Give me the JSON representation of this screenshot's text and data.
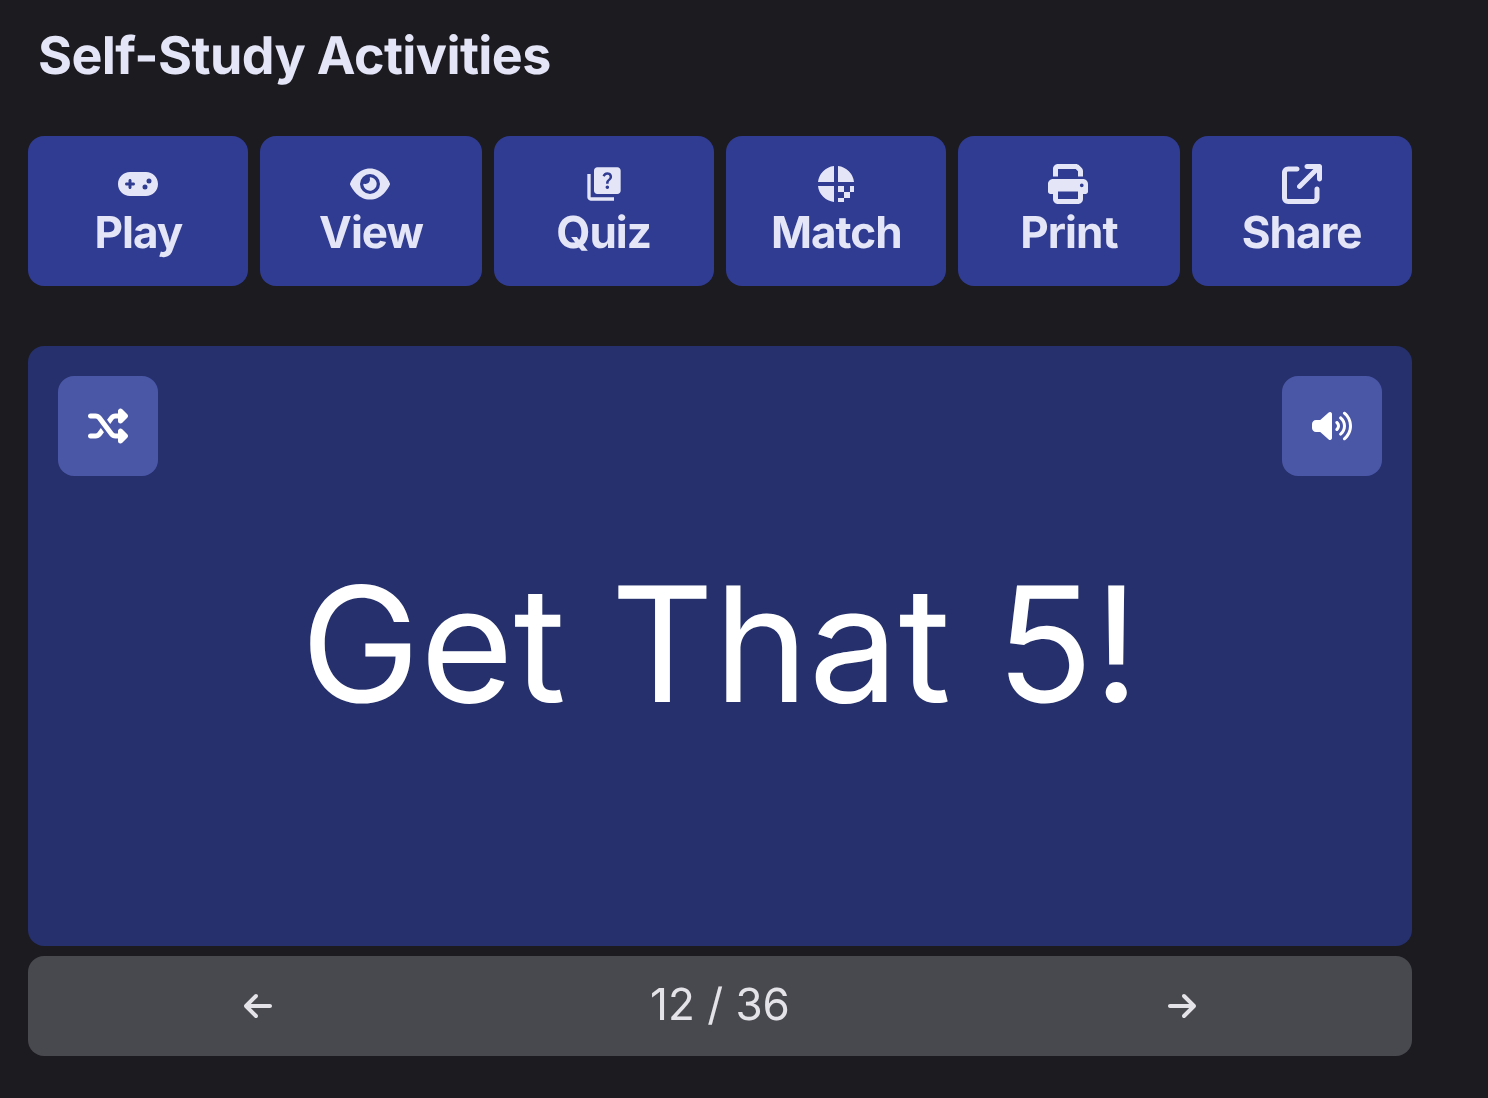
{
  "title": "Self-Study Activities",
  "activities": [
    {
      "kind": "play",
      "label": "Play"
    },
    {
      "kind": "view",
      "label": "View"
    },
    {
      "kind": "quiz",
      "label": "Quiz"
    },
    {
      "kind": "match",
      "label": "Match"
    },
    {
      "kind": "print",
      "label": "Print"
    },
    {
      "kind": "share",
      "label": "Share"
    }
  ],
  "card": {
    "text": "Get That 5!"
  },
  "pager": {
    "position": "12 / 36"
  }
}
